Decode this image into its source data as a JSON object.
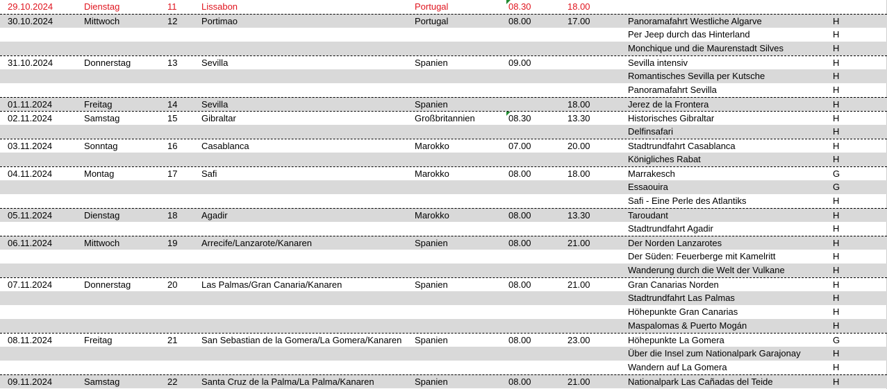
{
  "rows": [
    {
      "date": "29.10.2024",
      "day": "Dienstag",
      "num": "11",
      "port": "Lissabon",
      "country": "Portugal",
      "arr": "08.30",
      "dep": "18.00",
      "exc": "",
      "code": "",
      "red": true,
      "top": false,
      "shade": false,
      "marker": true
    },
    {
      "date": "30.10.2024",
      "day": "Mittwoch",
      "num": "12",
      "port": "Portimao",
      "country": "Portugal",
      "arr": "08.00",
      "dep": "17.00",
      "exc": "Panoramafahrt Westliche Algarve",
      "code": "H",
      "top": true,
      "shade": true
    },
    {
      "date": "",
      "day": "",
      "num": "",
      "port": "",
      "country": "",
      "arr": "",
      "dep": "",
      "exc": "Per Jeep durch das Hinterland",
      "code": "H",
      "shade": false
    },
    {
      "date": "",
      "day": "",
      "num": "",
      "port": "",
      "country": "",
      "arr": "",
      "dep": "",
      "exc": "Monchique und die Maurenstadt Silves",
      "code": "H",
      "shade": true
    },
    {
      "date": "31.10.2024",
      "day": "Donnerstag",
      "num": "13",
      "port": "Sevilla",
      "country": "Spanien",
      "arr": "09.00",
      "dep": "",
      "exc": "Sevilla intensiv",
      "code": "H",
      "top": true,
      "shade": false
    },
    {
      "date": "",
      "day": "",
      "num": "",
      "port": "",
      "country": "",
      "arr": "",
      "dep": "",
      "exc": "Romantisches Sevilla per Kutsche",
      "code": "H",
      "shade": true
    },
    {
      "date": "",
      "day": "",
      "num": "",
      "port": "",
      "country": "",
      "arr": "",
      "dep": "",
      "exc": "Panoramafahrt Sevilla",
      "code": "H",
      "shade": false
    },
    {
      "date": "01.11.2024",
      "day": "Freitag",
      "num": "14",
      "port": "Sevilla",
      "country": "Spanien",
      "arr": "",
      "dep": "18.00",
      "exc": "Jerez de la Frontera",
      "code": "H",
      "top": true,
      "shade": true
    },
    {
      "date": "02.11.2024",
      "day": "Samstag",
      "num": "15",
      "port": "Gibraltar",
      "country": "Großbritannien",
      "arr": "08.30",
      "dep": "13.30",
      "exc": "Historisches Gibraltar",
      "code": "H",
      "top": true,
      "shade": false,
      "marker": true
    },
    {
      "date": "",
      "day": "",
      "num": "",
      "port": "",
      "country": "",
      "arr": "",
      "dep": "",
      "exc": "Delfinsafari",
      "code": "H",
      "shade": true
    },
    {
      "date": "03.11.2024",
      "day": "Sonntag",
      "num": "16",
      "port": "Casablanca",
      "country": "Marokko",
      "arr": "07.00",
      "dep": "20.00",
      "exc": "Stadtrundfahrt Casablanca",
      "code": "H",
      "top": true,
      "shade": false
    },
    {
      "date": "",
      "day": "",
      "num": "",
      "port": "",
      "country": "",
      "arr": "",
      "dep": "",
      "exc": "Königliches Rabat",
      "code": "H",
      "shade": true
    },
    {
      "date": "04.11.2024",
      "day": "Montag",
      "num": "17",
      "port": "Safi",
      "country": "Marokko",
      "arr": "08.00",
      "dep": "18.00",
      "exc": "Marrakesch",
      "code": "G",
      "top": true,
      "shade": false
    },
    {
      "date": "",
      "day": "",
      "num": "",
      "port": "",
      "country": "",
      "arr": "",
      "dep": "",
      "exc": "Essaouira",
      "code": "G",
      "shade": true
    },
    {
      "date": "",
      "day": "",
      "num": "",
      "port": "",
      "country": "",
      "arr": "",
      "dep": "",
      "exc": "Safi - Eine Perle des Atlantiks",
      "code": "H",
      "shade": false
    },
    {
      "date": "05.11.2024",
      "day": "Dienstag",
      "num": "18",
      "port": "Agadir",
      "country": "Marokko",
      "arr": "08.00",
      "dep": "13.30",
      "exc": "Taroudant",
      "code": "H",
      "top": true,
      "shade": true
    },
    {
      "date": "",
      "day": "",
      "num": "",
      "port": "",
      "country": "",
      "arr": "",
      "dep": "",
      "exc": "Stadtrundfahrt Agadir",
      "code": "H",
      "shade": false
    },
    {
      "date": "06.11.2024",
      "day": "Mittwoch",
      "num": "19",
      "port": "Arrecife/Lanzarote/Kanaren",
      "country": "Spanien",
      "arr": "08.00",
      "dep": "21.00",
      "exc": "Der Norden Lanzarotes",
      "code": "H",
      "top": true,
      "shade": true
    },
    {
      "date": "",
      "day": "",
      "num": "",
      "port": "",
      "country": "",
      "arr": "",
      "dep": "",
      "exc": "Der Süden: Feuerberge mit Kamelritt",
      "code": "H",
      "shade": false
    },
    {
      "date": "",
      "day": "",
      "num": "",
      "port": "",
      "country": "",
      "arr": "",
      "dep": "",
      "exc": "Wanderung durch die Welt der Vulkane",
      "code": "H",
      "shade": true
    },
    {
      "date": "07.11.2024",
      "day": "Donnerstag",
      "num": "20",
      "port": "Las Palmas/Gran Canaria/Kanaren",
      "country": "Spanien",
      "arr": "08.00",
      "dep": "21.00",
      "exc": "Gran Canarias Norden",
      "code": "H",
      "top": true,
      "shade": false
    },
    {
      "date": "",
      "day": "",
      "num": "",
      "port": "",
      "country": "",
      "arr": "",
      "dep": "",
      "exc": "Stadtrundfahrt Las Palmas",
      "code": "H",
      "shade": true
    },
    {
      "date": "",
      "day": "",
      "num": "",
      "port": "",
      "country": "",
      "arr": "",
      "dep": "",
      "exc": "Höhepunkte Gran Canarias",
      "code": "H",
      "shade": false
    },
    {
      "date": "",
      "day": "",
      "num": "",
      "port": "",
      "country": "",
      "arr": "",
      "dep": "",
      "exc": "Maspalomas & Puerto Mogán",
      "code": "H",
      "shade": true
    },
    {
      "date": "08.11.2024",
      "day": "Freitag",
      "num": "21",
      "port": "San Sebastian de la Gomera/La Gomera/Kanaren",
      "country": "Spanien",
      "arr": "08.00",
      "dep": "23.00",
      "exc": "Höhepunkte La Gomera",
      "code": "G",
      "top": true,
      "shade": false
    },
    {
      "date": "",
      "day": "",
      "num": "",
      "port": "",
      "country": "",
      "arr": "",
      "dep": "",
      "exc": "Über die Insel zum Nationalpark Garajonay",
      "code": "H",
      "shade": true
    },
    {
      "date": "",
      "day": "",
      "num": "",
      "port": "",
      "country": "",
      "arr": "",
      "dep": "",
      "exc": "Wandern auf La Gomera",
      "code": "H",
      "shade": false
    },
    {
      "date": "09.11.2024",
      "day": "Samstag",
      "num": "22",
      "port": "Santa Cruz de la Palma/La Palma/Kanaren",
      "country": "Spanien",
      "arr": "08.00",
      "dep": "21.00",
      "exc": "Nationalpark Las Cañadas del Teide",
      "code": "H",
      "top": true,
      "shade": true
    }
  ],
  "colors": {
    "shade": "#d9d9d9",
    "red": "#e0141e",
    "marker": "#1e8a2e"
  }
}
